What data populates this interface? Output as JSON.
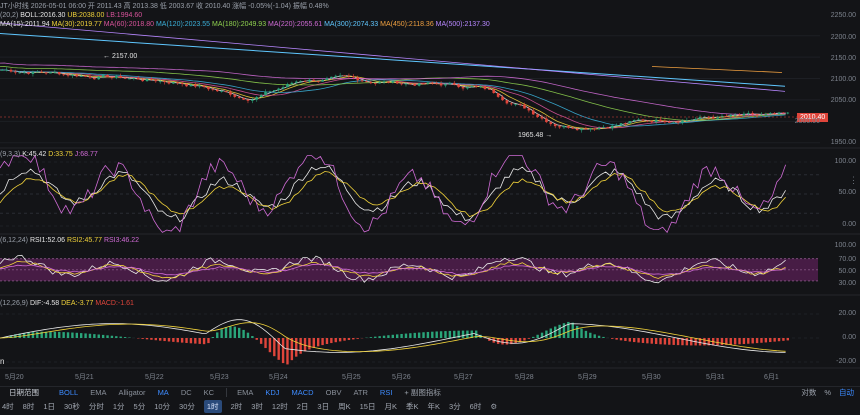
{
  "colors": {
    "bg": "#131417",
    "up": "#2aa57a",
    "down": "#e0453b",
    "ma15": "#e8e8e8",
    "ma30": "#f0d23a",
    "ma60": "#d9539b",
    "ma120": "#3bb0d9",
    "ma180": "#8fd14f",
    "ma220": "#d06bd6",
    "ma300": "#5fc7ff",
    "ma450": "#f0a040",
    "ma500": "#b787ff",
    "rsi_band": "#5a1f55"
  },
  "header": {
    "info_line": "JT小时线 2026-05-01 06:00 开 2011.43 高 2013.38 低 2003.67 收 2010.40 涨幅 -0.05%(-1.04) 振幅 0.48%",
    "boll_prefix": "(20,2)",
    "boll": "BOLL:2016.30",
    "ub": "UB:2038.00",
    "lb": "LB:1994.60",
    "ma15": "MA(15):2011.94",
    "ma30": "MA(30):2019.77",
    "ma60": "MA(60):2018.80",
    "ma120": "MA(120):2023.55",
    "ma180": "MA(180):2049.93",
    "ma220": "MA(220):2055.61",
    "ma300": "MA(300):2074.33",
    "ma450": "MA(450):2118.36",
    "ma500": "MA(500):2137.30"
  },
  "price_panel": {
    "axis_labels": [
      "2250.00",
      "2200.00",
      "2150.00",
      "2100.00",
      "2050.00",
      "2000.00",
      "1950.00"
    ],
    "current_price": "2010.40",
    "high_marker": "2157.00",
    "low_marker": "1965.48"
  },
  "kdj_panel": {
    "params": "(9,3,3)",
    "k": "K:45.42",
    "d": "D:33.75",
    "j": "J:68.77",
    "axis_labels": [
      "100.00",
      "50.00",
      "0.00"
    ]
  },
  "rsi_panel": {
    "params": "(6,12,24)",
    "rsi1": "RSI1:52.06",
    "rsi2": "RSI2:45.77",
    "rsi3": "RSI3:46.22",
    "axis_labels": [
      "100.00",
      "70.00",
      "50.00",
      "30.00"
    ]
  },
  "macd_panel": {
    "params": "(12,26,9)",
    "dif": "DIF:-4.58",
    "dea": "DEA:-3.77",
    "macd": "MACD:-1.61",
    "axis_labels": [
      "20.00",
      "0.00",
      "-20.00"
    ]
  },
  "date_axis": [
    "5月20",
    "5月21",
    "5月22",
    "5月23",
    "5月24",
    "5月25",
    "5月26",
    "5月27",
    "5月28",
    "5月29",
    "5月30",
    "5月31",
    "6月1"
  ],
  "indicator_bar": {
    "left_label": "日期范围",
    "main": [
      "BOLL",
      "EMA",
      "Alligator",
      "MA",
      "DC",
      "KC"
    ],
    "sub": [
      "EMA",
      "KDJ",
      "MACD",
      "OBV",
      "ATR",
      "RSI"
    ],
    "sub_extra": "+ 副图指标",
    "right": [
      "对数",
      "%",
      "自动"
    ]
  },
  "timeframes": [
    "4时",
    "8时",
    "1日",
    "30秒",
    "分时",
    "1分",
    "5分",
    "10分",
    "30分",
    "1时",
    "2时",
    "3时",
    "12时",
    "2日",
    "3日",
    "周K",
    "15日",
    "月K",
    "季K",
    "年K",
    "3分",
    "6时"
  ],
  "active_timeframe": "1时",
  "active_indicators": [
    "BOLL",
    "MA",
    "KDJ",
    "MACD",
    "RSI"
  ],
  "icons": [
    "settings-icon"
  ]
}
